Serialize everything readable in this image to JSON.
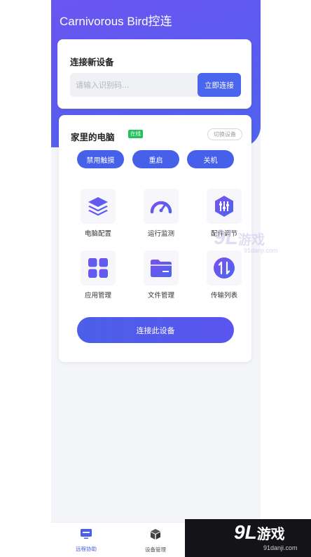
{
  "app": {
    "title": "Carnivorous Bird控连"
  },
  "connect_card": {
    "title": "连接新设备",
    "input_placeholder": "请输入识别码...",
    "connect_button": "立即连接"
  },
  "device_card": {
    "name": "家里的电脑",
    "status_badge": "在线",
    "switch_button": "切换设备",
    "actions": [
      "禁用触摸",
      "重启",
      "关机"
    ],
    "features": [
      {
        "label": "电脑配置",
        "icon": "layers-icon"
      },
      {
        "label": "运行监测",
        "icon": "gauge-icon"
      },
      {
        "label": "配件调节",
        "icon": "sliders-icon"
      },
      {
        "label": "应用管理",
        "icon": "apps-grid-icon"
      },
      {
        "label": "文件管理",
        "icon": "folder-icon"
      },
      {
        "label": "传输列表",
        "icon": "transfer-icon"
      }
    ],
    "connect_device_button": "连接此设备"
  },
  "tabbar": {
    "tabs": [
      {
        "label": "远程协助",
        "icon": "remote-assist-icon",
        "active": true
      },
      {
        "label": "设备管理",
        "icon": "cube-icon",
        "active": false
      }
    ]
  },
  "watermark": {
    "logo_text": "9L",
    "brand_text": "游戏",
    "site": "91danji.com"
  },
  "colors": {
    "accent": "#4a66ee",
    "gradient_start": "#6b55f0",
    "online": "#22c25a",
    "icon_gradient_start": "#7b4ff0",
    "icon_gradient_end": "#4a66ee"
  }
}
